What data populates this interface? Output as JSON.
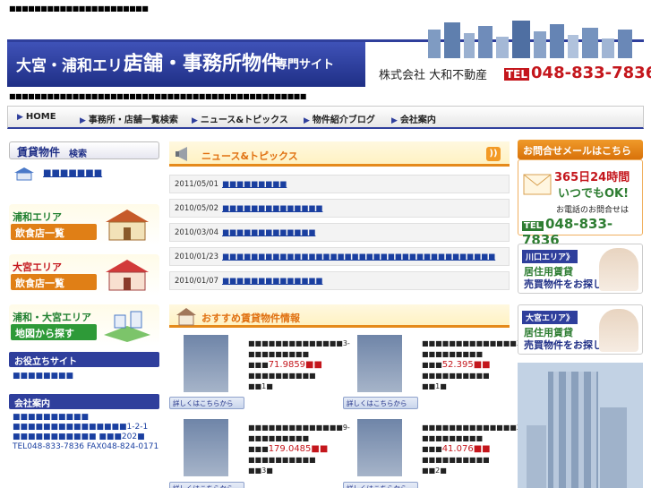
{
  "top_note": "■■■■■■■■■■■■■■■■■■■■■■",
  "banner": {
    "area": "大宮・浦和エリア",
    "main": "店舗・事務所物件",
    "suffix": "専門サイト",
    "company": "株式会社 大和不動産",
    "tel_label": "TEL",
    "tel": "048-833-7836"
  },
  "sub_note": "■■■■■■■■■■■■■■■■■■■■■■■■■■■■■■■■■■■■■■■■■■■■■■■",
  "nav": [
    {
      "label": "HOME"
    },
    {
      "label": "事務所・店舗一覧検索"
    },
    {
      "label": "ニュース&トピックス"
    },
    {
      "label": "物件紹介ブログ"
    },
    {
      "label": "会社案内"
    }
  ],
  "sidebar": {
    "search_title_a": "賃貸物件",
    "search_title_b": "検索",
    "house_link": "■■■■■■■",
    "cards": [
      {
        "line1": "浦和エリア",
        "line2": "飲食店一覧"
      },
      {
        "line1": "大宮エリア",
        "line2": "飲食店一覧"
      },
      {
        "line1": "浦和・大宮エリア",
        "line2": "地図から探す"
      }
    ],
    "useful_title": "お役立ちサイト",
    "useful_link": "■■■■■■■■",
    "company_title": "会社案内",
    "company_lines": [
      "■■■■■■■■■■",
      "■■■■■■■■■■■■■■■1-2-1",
      "■■■■■■■■■■■ ■■■202■",
      "TEL048-833-7836 FAX048-824-0171"
    ]
  },
  "news": {
    "title": "ニュース&トピックス",
    "rss": "RSS",
    "items": [
      {
        "date": "2011/05/01",
        "text": "■■■■■■■■■"
      },
      {
        "date": "2010/05/02",
        "text": "■■■■■■■■■■■■■■"
      },
      {
        "date": "2010/03/04",
        "text": "■■■■■■■■■■■■■"
      },
      {
        "date": "2010/01/23",
        "text": "■■■■■■■■■■■■■■■■■■■■■■■■■■■■■■■■■■■■■■"
      },
      {
        "date": "2010/01/07",
        "text": "■■■■■■■■■■■■■■"
      }
    ]
  },
  "recommend": {
    "title": "おすすめ賃貸物件情報",
    "detail_label": "詳しくはこちらから",
    "props": [
      {
        "l1": "■■■■■■■■■■■■■■3-",
        "l2": "■■■■■■■■■",
        "price": "71.9859",
        "l3": "■■■■■■■■■■",
        "l4": "■■1■"
      },
      {
        "l1": "■■■■■■■■■■■■■■3-",
        "l2": "■■■■■■■■■",
        "price": "52.395",
        "l3": "■■■■■■■■■■",
        "l4": "■■1■"
      },
      {
        "l1": "■■■■■■■■■■■■■■9-",
        "l2": "■■■■■■■■■",
        "price": "179.0485",
        "l3": "■■■■■■■■■■",
        "l4": "■■3■"
      },
      {
        "l1": "■■■■■■■■■■■■■■25-",
        "l2": "■■■■■■■■■",
        "price": "41.076",
        "l3": "■■■■■■■■■■",
        "l4": "■■2■"
      }
    ]
  },
  "right": {
    "mail_title": "お問合せメールはこちら",
    "hours": "365日24時間",
    "ok": "いつでもOK!",
    "phone_note": "お電話のお問合せは",
    "tel_label": "TEL",
    "tel": "048-833-7836",
    "areas": [
      {
        "tag": "川口エリア》",
        "a1": "居住用賃貸",
        "a2": "売買物件をお探しの方"
      },
      {
        "tag": "大宮エリア》",
        "a1": "居住用賃貸",
        "a2": "売買物件をお探しの方"
      }
    ]
  }
}
